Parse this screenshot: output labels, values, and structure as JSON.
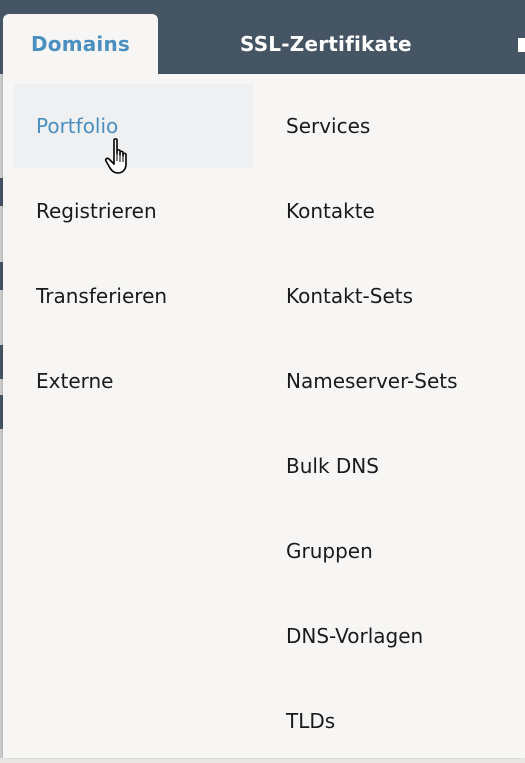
{
  "nav": {
    "tabs": [
      {
        "label": "Domains",
        "active": true
      },
      {
        "label": "SSL-Zertifikate",
        "active": false
      }
    ]
  },
  "menu": {
    "left_column": [
      {
        "label": "Portfolio",
        "active": true
      },
      {
        "label": "Registrieren",
        "active": false
      },
      {
        "label": "Transferieren",
        "active": false
      },
      {
        "label": "Externe",
        "active": false
      }
    ],
    "right_column": [
      {
        "label": "Services"
      },
      {
        "label": "Kontakte"
      },
      {
        "label": "Kontakt-Sets"
      },
      {
        "label": "Nameserver-Sets"
      },
      {
        "label": "Bulk DNS"
      },
      {
        "label": "Gruppen"
      },
      {
        "label": "DNS-Vorlagen"
      },
      {
        "label": "TLDs"
      }
    ]
  },
  "colors": {
    "topbar": "#465564",
    "accent": "#4a8fbf",
    "panel": "#f7f6f4",
    "active_item_bg": "#eef0f2"
  },
  "icons": {
    "cursor": "hand-pointer-icon"
  }
}
